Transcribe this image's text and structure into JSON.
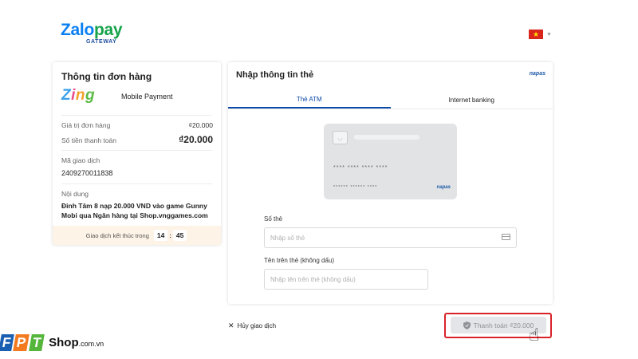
{
  "brand": {
    "logo_zalo": "Zalo",
    "logo_pay": "pay",
    "logo_sub": "GATEWAY"
  },
  "language": {
    "flag_star": "★",
    "caret": "▼"
  },
  "order": {
    "title": "Thông tin đơn hàng",
    "merchant_logo": [
      "Z",
      "i",
      "n",
      "g"
    ],
    "merchant_name": "Mobile Payment",
    "amount_label": "Giá trị đơn hàng",
    "amount_value": "₫20.000",
    "total_label": "Số tiền thanh toán",
    "total_value": "₫20.000",
    "txn_label": "Mã giao dịch",
    "txn_id": "2409270011838",
    "content_label": "Nội dung",
    "content_text": "Đinh Tâm 8 nạp 20.000 VND vào game Gunny Mobi qua Ngân hàng tại Shop.vnggames.com",
    "timer_label": "Giao dịch kết thúc trong",
    "timer_min": "14",
    "timer_sep": ":",
    "timer_sec": "45"
  },
  "card": {
    "title": "Nhập thông tin thẻ",
    "napas": "napas",
    "tabs": [
      {
        "label": "Thẻ ATM",
        "active": true
      },
      {
        "label": "Internet banking",
        "active": false
      }
    ],
    "illustration": {
      "number": "**** **** **** ****",
      "name": "****** ****** ****",
      "napas": "napas"
    },
    "card_number_label": "Số thẻ",
    "card_number_placeholder": "Nhập số thẻ",
    "card_name_label": "Tên trên thẻ (không dấu)",
    "card_name_placeholder": "Nhập tên trên thẻ (không dấu)"
  },
  "actions": {
    "cancel_icon": "✕",
    "cancel_label": "Hủy giao dịch",
    "pay_label": "Thanh toán ₫20.000"
  },
  "watermark": {
    "letters": [
      "F",
      "P",
      "T"
    ],
    "shop": "Shop",
    "domain": ".com.vn"
  },
  "colors": {
    "accent": "#0b4aa8",
    "highlight": "#d9222a",
    "timer_bg": "#fdf3e6"
  }
}
